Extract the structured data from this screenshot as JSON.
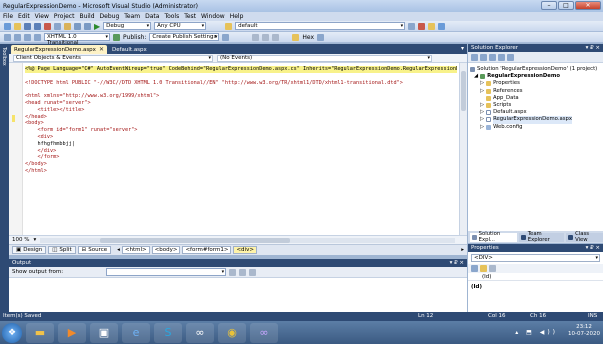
{
  "window": {
    "title": "RegularExpressionDemo - Microsoft Visual Studio (Administrator)",
    "minimize": "–",
    "maximize": "□",
    "close": "✕"
  },
  "menu": [
    "File",
    "Edit",
    "View",
    "Project",
    "Build",
    "Debug",
    "Team",
    "Data",
    "Tools",
    "Test",
    "Window",
    "Help"
  ],
  "toolbar": {
    "config": "Debug",
    "platform": "Any CPU",
    "find": "default",
    "doctype": "XHTML 1.0 Transitional",
    "publish": "Publish:",
    "publish_profile": "Create Publish Settings",
    "hex": "Hex"
  },
  "side_strip": [
    "Toolbox"
  ],
  "doc_tabs": [
    {
      "label": "RegularExpressionDemo.aspx",
      "active": true
    },
    {
      "label": "Default.aspx",
      "active": false
    }
  ],
  "nav": {
    "left": "Client Objects & Events",
    "right": "(No Events)"
  },
  "code_lines": [
    "<%@ Page Language=\"C#\" AutoEventWireup=\"true\" CodeBehind=\"RegularExpressionDemo.aspx.cs\" Inherits=\"RegularExpressionDemo.RegularExpressionDe",
    "",
    "<!DOCTYPE html PUBLIC \"-//W3C//DTD XHTML 1.0 Transitional//EN\" \"http://www.w3.org/TR/xhtml1/DTD/xhtml1-transitional.dtd\">",
    "",
    "<html xmlns=\"http://www.w3.org/1999/xhtml\">",
    "<head runat=\"server\">",
    "    <title></title>",
    "</head>",
    "<body>",
    "    <form id=\"form1\" runat=\"server\">",
    "    <div>",
    "    hfhgfhmbbjj|",
    "    </div>",
    "    </form>",
    "</body>",
    "</html>"
  ],
  "zoom": "100 %",
  "view_bar": {
    "design": "Design",
    "split": "Split",
    "source": "Source",
    "crumbs": [
      "<html>",
      "<body>",
      "<form#form1>",
      "<div>"
    ]
  },
  "output": {
    "title": "Output",
    "show_from": "Show output from:",
    "pin": "▾ ₽ ×"
  },
  "solution_explorer": {
    "title": "Solution Explorer",
    "pin": "▾ ₽ ×",
    "items": [
      {
        "label": "Solution 'RegularExpressionDemo' (1 project)",
        "icon": "solution-icon",
        "indent": 0
      },
      {
        "label": "RegularExpressionDemo",
        "icon": "project-icon",
        "indent": 1,
        "bold": true
      },
      {
        "label": "Properties",
        "icon": "folder-icon",
        "indent": 2
      },
      {
        "label": "References",
        "icon": "folder-icon",
        "indent": 2
      },
      {
        "label": "App_Data",
        "icon": "folder-icon",
        "indent": 2
      },
      {
        "label": "Scripts",
        "icon": "folder-icon",
        "indent": 2
      },
      {
        "label": "Default.aspx",
        "icon": "file-icon",
        "indent": 2
      },
      {
        "label": "RegularExpressionDemo.aspx",
        "icon": "file-icon",
        "indent": 2,
        "highlight": true
      },
      {
        "label": "Web.config",
        "icon": "config-icon",
        "indent": 2
      }
    ]
  },
  "bottom_tabs": [
    "Solution Expl...",
    "Team Explorer",
    "Class View"
  ],
  "properties": {
    "title": "Properties",
    "selected": "<DIV>",
    "row": "(Id)",
    "desc": "(Id)"
  },
  "status": {
    "left": "Item(s) Saved",
    "ln": "Ln 12",
    "col": "Col 16",
    "ch": "Ch 16",
    "ins": "INS"
  },
  "taskbar": {
    "time": "23:12",
    "date": "10-07-2020"
  },
  "colors": {
    "accent": "#2e4a74",
    "tag": "#a31515",
    "attr": "#ff0000",
    "value": "#0000ff"
  }
}
